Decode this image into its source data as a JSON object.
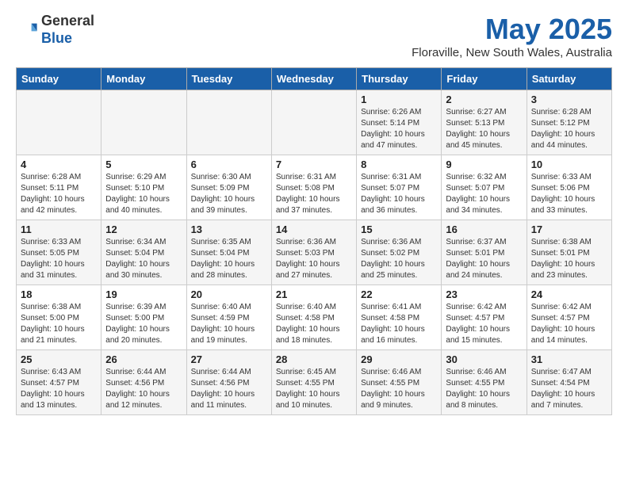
{
  "header": {
    "logo_general": "General",
    "logo_blue": "Blue",
    "month_title": "May 2025",
    "location": "Floraville, New South Wales, Australia"
  },
  "days_of_week": [
    "Sunday",
    "Monday",
    "Tuesday",
    "Wednesday",
    "Thursday",
    "Friday",
    "Saturday"
  ],
  "weeks": [
    [
      {
        "day": "",
        "info": ""
      },
      {
        "day": "",
        "info": ""
      },
      {
        "day": "",
        "info": ""
      },
      {
        "day": "",
        "info": ""
      },
      {
        "day": "1",
        "info": "Sunrise: 6:26 AM\nSunset: 5:14 PM\nDaylight: 10 hours\nand 47 minutes."
      },
      {
        "day": "2",
        "info": "Sunrise: 6:27 AM\nSunset: 5:13 PM\nDaylight: 10 hours\nand 45 minutes."
      },
      {
        "day": "3",
        "info": "Sunrise: 6:28 AM\nSunset: 5:12 PM\nDaylight: 10 hours\nand 44 minutes."
      }
    ],
    [
      {
        "day": "4",
        "info": "Sunrise: 6:28 AM\nSunset: 5:11 PM\nDaylight: 10 hours\nand 42 minutes."
      },
      {
        "day": "5",
        "info": "Sunrise: 6:29 AM\nSunset: 5:10 PM\nDaylight: 10 hours\nand 40 minutes."
      },
      {
        "day": "6",
        "info": "Sunrise: 6:30 AM\nSunset: 5:09 PM\nDaylight: 10 hours\nand 39 minutes."
      },
      {
        "day": "7",
        "info": "Sunrise: 6:31 AM\nSunset: 5:08 PM\nDaylight: 10 hours\nand 37 minutes."
      },
      {
        "day": "8",
        "info": "Sunrise: 6:31 AM\nSunset: 5:07 PM\nDaylight: 10 hours\nand 36 minutes."
      },
      {
        "day": "9",
        "info": "Sunrise: 6:32 AM\nSunset: 5:07 PM\nDaylight: 10 hours\nand 34 minutes."
      },
      {
        "day": "10",
        "info": "Sunrise: 6:33 AM\nSunset: 5:06 PM\nDaylight: 10 hours\nand 33 minutes."
      }
    ],
    [
      {
        "day": "11",
        "info": "Sunrise: 6:33 AM\nSunset: 5:05 PM\nDaylight: 10 hours\nand 31 minutes."
      },
      {
        "day": "12",
        "info": "Sunrise: 6:34 AM\nSunset: 5:04 PM\nDaylight: 10 hours\nand 30 minutes."
      },
      {
        "day": "13",
        "info": "Sunrise: 6:35 AM\nSunset: 5:04 PM\nDaylight: 10 hours\nand 28 minutes."
      },
      {
        "day": "14",
        "info": "Sunrise: 6:36 AM\nSunset: 5:03 PM\nDaylight: 10 hours\nand 27 minutes."
      },
      {
        "day": "15",
        "info": "Sunrise: 6:36 AM\nSunset: 5:02 PM\nDaylight: 10 hours\nand 25 minutes."
      },
      {
        "day": "16",
        "info": "Sunrise: 6:37 AM\nSunset: 5:01 PM\nDaylight: 10 hours\nand 24 minutes."
      },
      {
        "day": "17",
        "info": "Sunrise: 6:38 AM\nSunset: 5:01 PM\nDaylight: 10 hours\nand 23 minutes."
      }
    ],
    [
      {
        "day": "18",
        "info": "Sunrise: 6:38 AM\nSunset: 5:00 PM\nDaylight: 10 hours\nand 21 minutes."
      },
      {
        "day": "19",
        "info": "Sunrise: 6:39 AM\nSunset: 5:00 PM\nDaylight: 10 hours\nand 20 minutes."
      },
      {
        "day": "20",
        "info": "Sunrise: 6:40 AM\nSunset: 4:59 PM\nDaylight: 10 hours\nand 19 minutes."
      },
      {
        "day": "21",
        "info": "Sunrise: 6:40 AM\nSunset: 4:58 PM\nDaylight: 10 hours\nand 18 minutes."
      },
      {
        "day": "22",
        "info": "Sunrise: 6:41 AM\nSunset: 4:58 PM\nDaylight: 10 hours\nand 16 minutes."
      },
      {
        "day": "23",
        "info": "Sunrise: 6:42 AM\nSunset: 4:57 PM\nDaylight: 10 hours\nand 15 minutes."
      },
      {
        "day": "24",
        "info": "Sunrise: 6:42 AM\nSunset: 4:57 PM\nDaylight: 10 hours\nand 14 minutes."
      }
    ],
    [
      {
        "day": "25",
        "info": "Sunrise: 6:43 AM\nSunset: 4:57 PM\nDaylight: 10 hours\nand 13 minutes."
      },
      {
        "day": "26",
        "info": "Sunrise: 6:44 AM\nSunset: 4:56 PM\nDaylight: 10 hours\nand 12 minutes."
      },
      {
        "day": "27",
        "info": "Sunrise: 6:44 AM\nSunset: 4:56 PM\nDaylight: 10 hours\nand 11 minutes."
      },
      {
        "day": "28",
        "info": "Sunrise: 6:45 AM\nSunset: 4:55 PM\nDaylight: 10 hours\nand 10 minutes."
      },
      {
        "day": "29",
        "info": "Sunrise: 6:46 AM\nSunset: 4:55 PM\nDaylight: 10 hours\nand 9 minutes."
      },
      {
        "day": "30",
        "info": "Sunrise: 6:46 AM\nSunset: 4:55 PM\nDaylight: 10 hours\nand 8 minutes."
      },
      {
        "day": "31",
        "info": "Sunrise: 6:47 AM\nSunset: 4:54 PM\nDaylight: 10 hours\nand 7 minutes."
      }
    ]
  ]
}
